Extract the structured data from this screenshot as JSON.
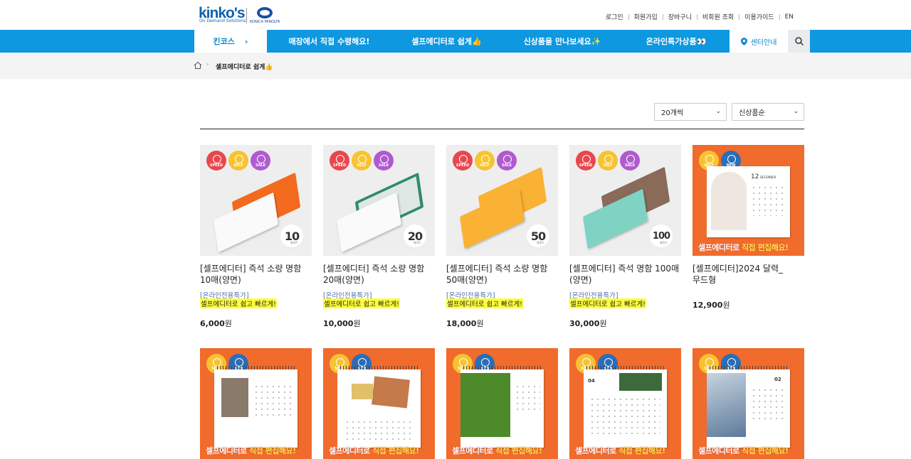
{
  "header": {
    "logo_text": "kinko's",
    "logo_sub": "On Demand Solutions",
    "partner_logo": "KONICA MINOLTA",
    "util_links": [
      "로그인",
      "회원가입",
      "장바구니",
      "비회원 조회",
      "이용가이드",
      "EN"
    ]
  },
  "nav": {
    "first": "킨코스",
    "items": [
      "매장에서 직접 수령해요!",
      "셀프에디터로 쉽게👍",
      "신상품을 만나보세요✨",
      "온라인특가상품👀"
    ],
    "center": "센터안내",
    "accent": "#0d98e0"
  },
  "breadcrumb": {
    "current": "셀프에디터로 쉽게👍"
  },
  "filters": {
    "count": "20개씩",
    "sort": "신상품순"
  },
  "products": [
    {
      "title": "[셀프에디터] 즉석 소량 명함 10매(양면)",
      "tag1": "[온라인전용특가]",
      "tag2": "셀프에디터로 쉽고 빠르게!",
      "price": "6,000",
      "unit": "원",
      "qty": "10",
      "qty_sub": "매/EA",
      "badges": [
        "SPEED",
        "SELF",
        "SALE"
      ]
    },
    {
      "title": "[셀프에디터] 즉석 소량 명함 20매(양면)",
      "tag1": "[온라인전용특가]",
      "tag2": "셀프에디터로 쉽고 빠르게!",
      "price": "10,000",
      "unit": "원",
      "qty": "20",
      "qty_sub": "매/EA",
      "badges": [
        "SPEED",
        "SELF",
        "SALE"
      ]
    },
    {
      "title": "[셀프에디터] 즉석 소량 명함 50매(양면)",
      "tag1": "[온라인전용특가]",
      "tag2": "셀프에디터로 쉽고 빠르게!",
      "price": "18,000",
      "unit": "원",
      "qty": "50",
      "qty_sub": "매/EA",
      "badges": [
        "SPEED",
        "SELF",
        "SALE"
      ]
    },
    {
      "title": "[셀프에디터] 즉석 명함 100매(양면)",
      "tag1": "[온라인전용특가]",
      "tag2": "셀프에디터로 쉽고 빠르게!",
      "price": "30,000",
      "unit": "원",
      "qty": "100",
      "qty_sub": "매/EA",
      "badges": [
        "SPEED",
        "SELF",
        "SALE"
      ]
    },
    {
      "title": "[셀프에디터]2024 달력_무드형",
      "tag1": "",
      "tag2": "",
      "price": "12,900",
      "unit": "원",
      "cal_month": "12",
      "cal_month_name": "DECEMBER",
      "badges": [
        "SELF",
        "NEW"
      ]
    }
  ],
  "calendar_banner": {
    "pre": "셀프에디터로 ",
    "em": "직접 편집해요!"
  },
  "row2_badges": [
    "SELF",
    "NEW"
  ],
  "row2_labels": {
    "cal3": "04",
    "cal4": "02"
  }
}
